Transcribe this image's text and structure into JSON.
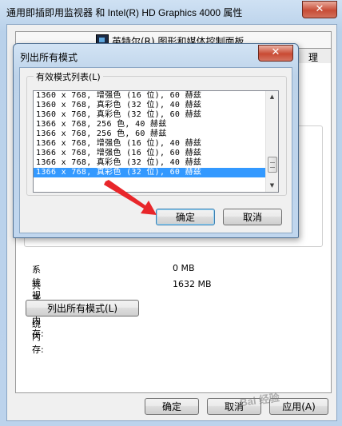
{
  "outer_window": {
    "title": "通用即插即用监视器 和 Intel(R) HD Graphics 4000 属性",
    "close_glyph": "✕",
    "tab_top": "英特尔(R) 图形和媒体控制面板",
    "tab_peek": "理",
    "info_rows": [
      {
        "label": "系统视频内存:",
        "value": "0 MB"
      },
      {
        "label": "共享系统内存:",
        "value": "1632 MB"
      }
    ],
    "list_all_modes_label": "列出所有模式(L)",
    "ok_label": "确定",
    "cancel_label": "取消",
    "apply_label": "应用(A)"
  },
  "dialog": {
    "title": "列出所有模式",
    "close_glyph": "✕",
    "group_label": "有效模式列表(L)",
    "modes": [
      "1360 x 768, 增强色 (16 位), 60 赫兹",
      "1360 x 768, 真彩色 (32 位), 40 赫兹",
      "1360 x 768, 真彩色 (32 位), 60 赫兹",
      "1366 x 768, 256 色, 40 赫兹",
      "1366 x 768, 256 色, 60 赫兹",
      "1366 x 768, 增强色 (16 位), 40 赫兹",
      "1366 x 768, 增强色 (16 位), 60 赫兹",
      "1366 x 768, 真彩色 (32 位), 40 赫兹",
      "1366 x 768, 真彩色 (32 位), 60 赫兹"
    ],
    "selected_index": 8,
    "ok_label": "确定",
    "cancel_label": "取消"
  },
  "watermark": "Bai 经验",
  "colors": {
    "selection": "#3399ff",
    "annotation_arrow": "#e8262a",
    "close_button": "#c74c36"
  }
}
